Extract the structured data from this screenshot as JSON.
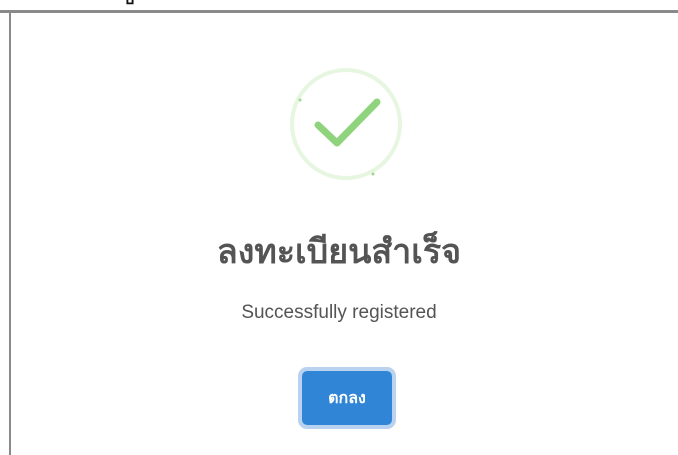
{
  "top_fragment": "ป",
  "dialog": {
    "title": "ลงทะเบียนสำเร็จ",
    "subtitle": "Successfully registered",
    "confirm_label": "ตกลง",
    "icon": "success-check",
    "colors": {
      "check": "#8fd47c",
      "ring": "#e7f6e1",
      "title_text": "#545454",
      "button": "#3085d6",
      "button_text": "#ffffff"
    }
  }
}
